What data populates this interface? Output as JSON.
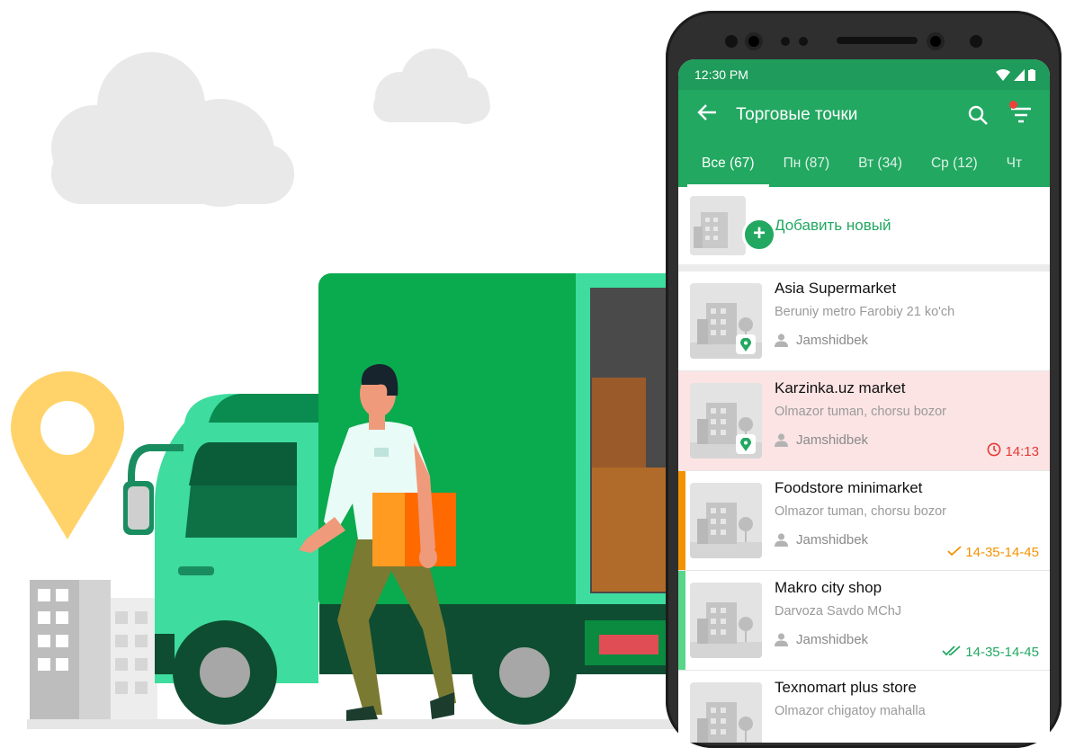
{
  "status_bar": {
    "time": "12:30 PM"
  },
  "app_bar": {
    "title": "Торговые точки"
  },
  "tabs": [
    {
      "label": "Все (67)",
      "active": true
    },
    {
      "label": "Пн (87)",
      "active": false
    },
    {
      "label": "Вт (34)",
      "active": false
    },
    {
      "label": "Ср (12)",
      "active": false
    },
    {
      "label": "Чт",
      "active": false
    }
  ],
  "add_new": {
    "label": "Добавить новый"
  },
  "outlets": [
    {
      "name": "Asia Supermarket",
      "address": "Beruniy metro Farobiy 21 ko'ch",
      "agent": "Jamshidbek",
      "time": "",
      "status": "none",
      "has_pin": true
    },
    {
      "name": "Karzinka.uz market",
      "address": "Olmazor tuman, chorsu bozor",
      "agent": "Jamshidbek",
      "time": "14:13",
      "status": "late",
      "has_pin": true
    },
    {
      "name": "Foodstore minimarket",
      "address": "Olmazor tuman, chorsu bozor",
      "agent": "Jamshidbek",
      "time": "14-35-14-45",
      "status": "visited",
      "has_pin": false
    },
    {
      "name": "Makro city shop",
      "address": "Darvoza Savdo MChJ",
      "agent": "Jamshidbek",
      "time": "14-35-14-45",
      "status": "done",
      "has_pin": false
    },
    {
      "name": "Texnomart plus store",
      "address": "Olmazor chigatoy mahalla",
      "agent": "",
      "time": "",
      "status": "none",
      "has_pin": false
    }
  ],
  "colors": {
    "primary": "#22a861",
    "status_bar": "#1f9b5b",
    "late": "#e53935",
    "visited": "#f39200",
    "done": "#22a861",
    "alert_bg": "#fce4e4",
    "illustration_green": "#0aaa4e",
    "illustration_mint": "#3edc9e",
    "pin_yellow": "#ffd36a"
  },
  "icons": {
    "back": "arrow-left-icon",
    "search": "search-icon",
    "filter": "filter-icon",
    "add": "plus-icon",
    "agent": "person-icon",
    "clock": "clock-icon",
    "check": "check-icon",
    "double_check": "double-check-icon",
    "location": "location-pin-icon"
  }
}
